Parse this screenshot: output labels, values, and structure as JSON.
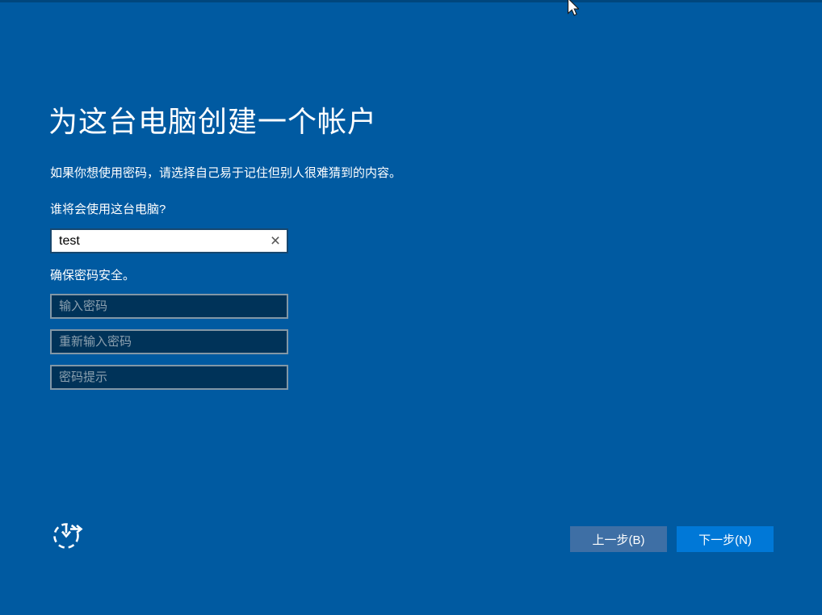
{
  "content": {
    "title": "为这台电脑创建一个帐户",
    "subtitle": "如果你想使用密码，请选择自己易于记住但别人很难猜到的内容。",
    "account": {
      "question_label": "谁将会使用这台电脑?",
      "username": {
        "value": "test",
        "clear_glyph": "×"
      }
    },
    "password": {
      "section_label": "确保密码安全。",
      "fields": [
        {
          "placeholder": "输入密码"
        },
        {
          "placeholder": "重新输入密码"
        },
        {
          "placeholder": "密码提示"
        }
      ]
    }
  },
  "footer": {
    "back_label": "上一步(B)",
    "next_label": "下一步(N)"
  },
  "icons": {
    "ease_of_access": "ease-of-access-icon",
    "clear": "clear-x-icon",
    "cursor": "arrow-cursor"
  },
  "colors": {
    "background": "#005AA1",
    "next_button": "#0078D7",
    "back_button": "#3E6FA5",
    "field_background": "#003359",
    "field_border": "#8297A6",
    "username_border": "#17476F",
    "placeholder_text": "#8CA0AF"
  }
}
